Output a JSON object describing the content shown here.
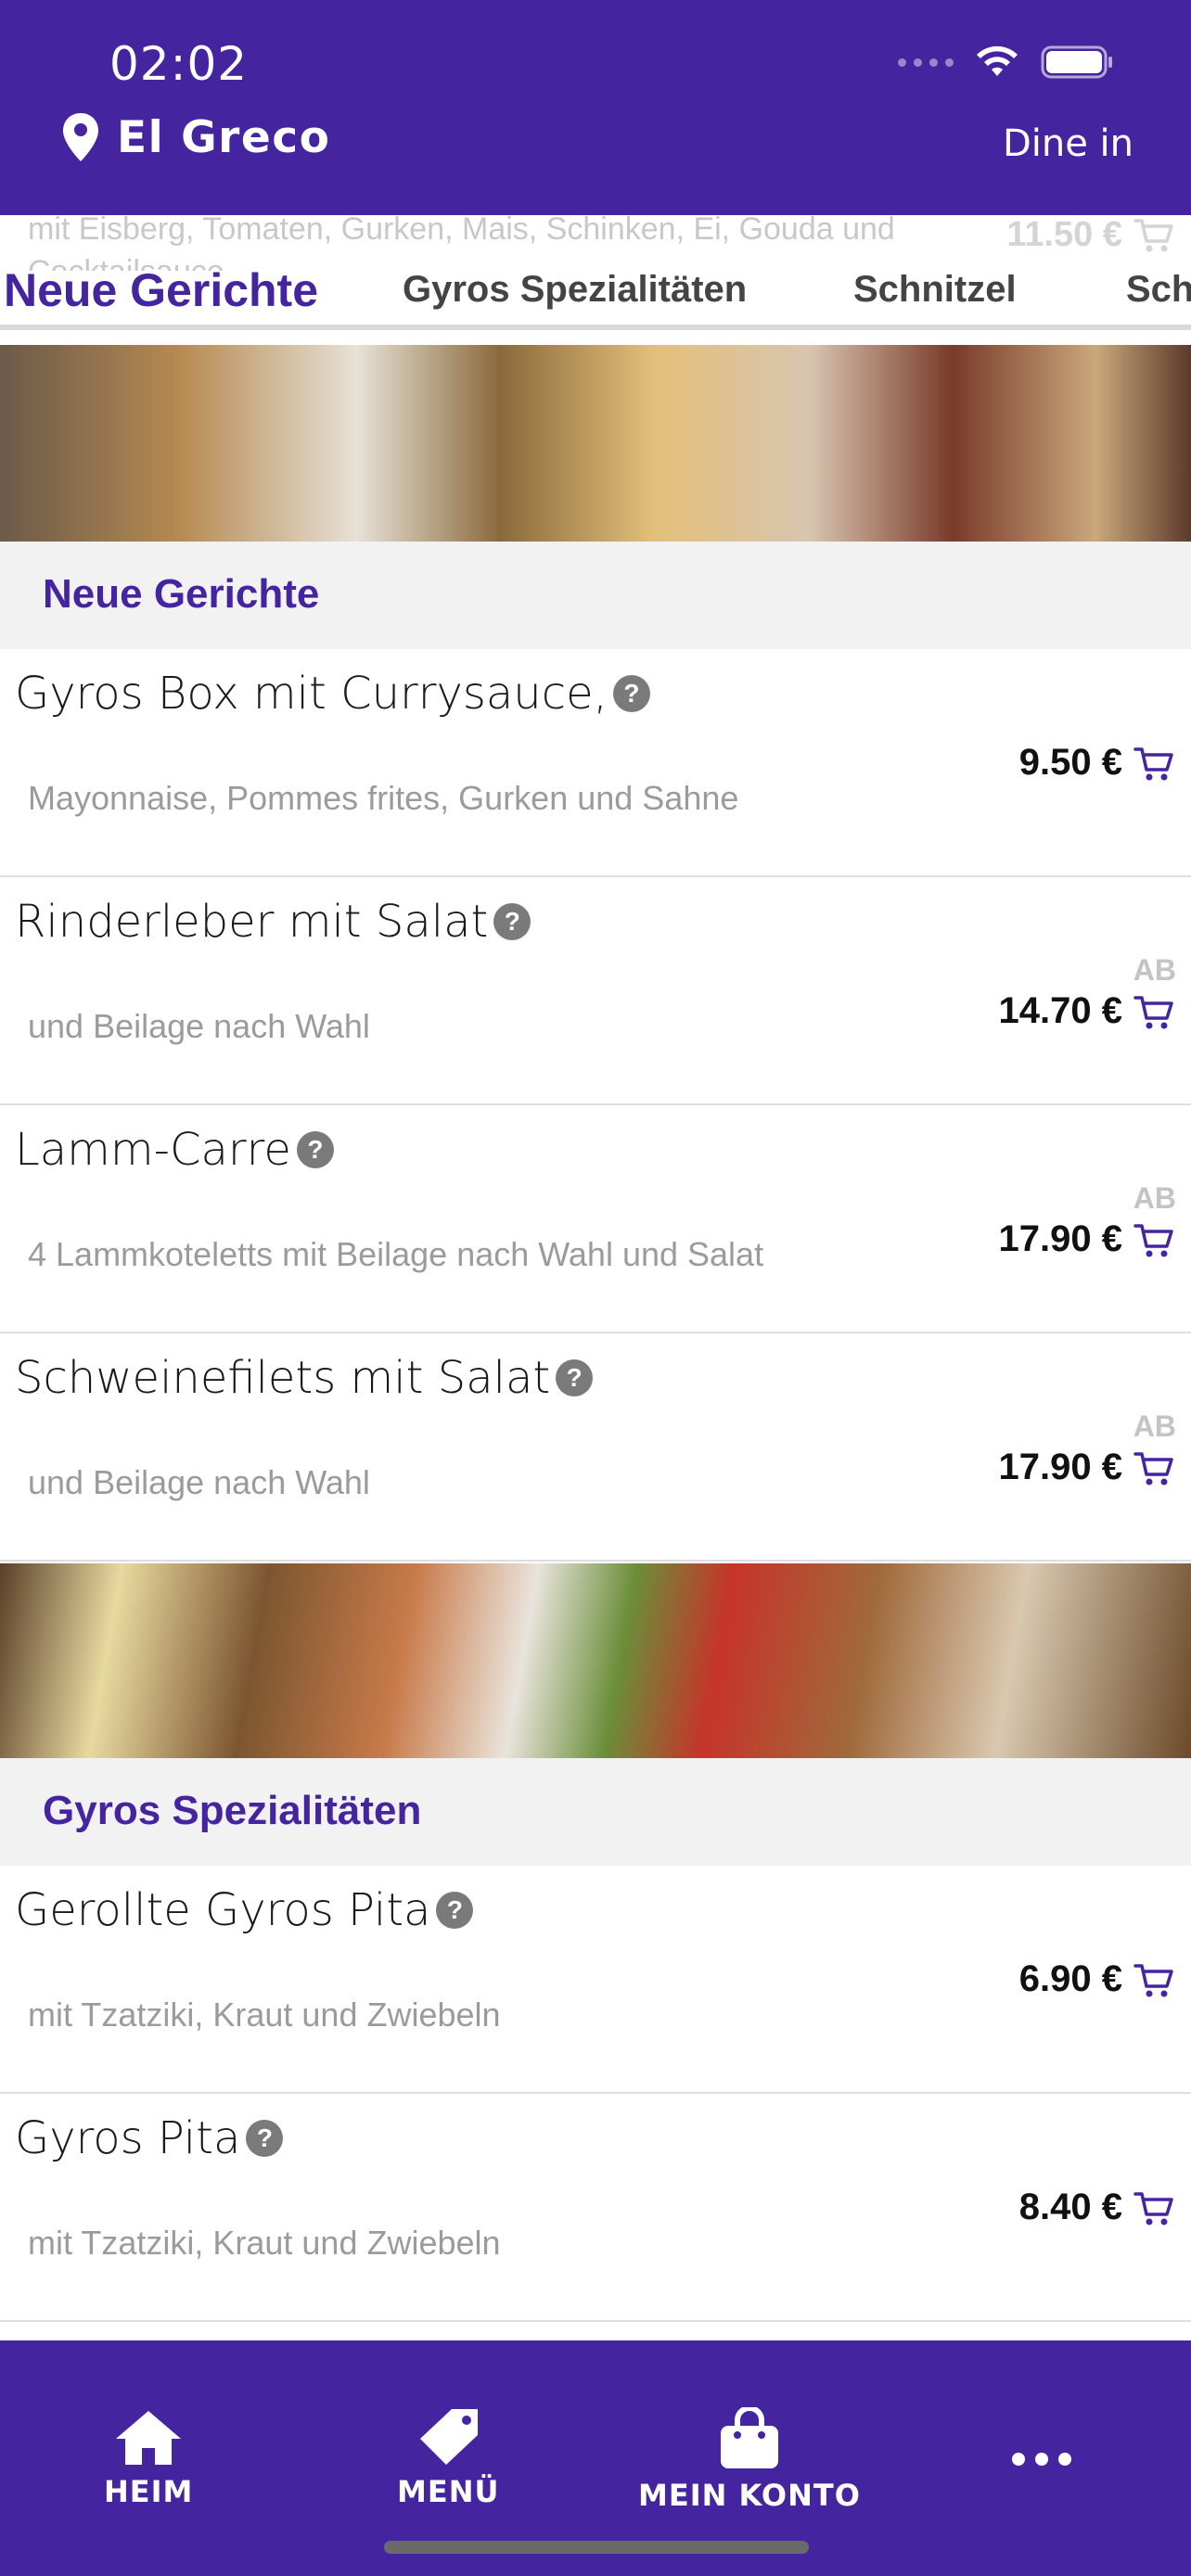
{
  "status_bar": {
    "time": "02:02"
  },
  "header": {
    "restaurant_name": "El Greco",
    "order_mode": "Dine in"
  },
  "peek_item": {
    "description": "mit Eisberg, Tomaten, Gurken, Mais, Schinken, Ei, Gouda und Cocktailsauce",
    "price": "11.50 €"
  },
  "tabs": [
    {
      "label": "Neue Gerichte",
      "active": true
    },
    {
      "label": "Gyros Spezialitäten",
      "active": false
    },
    {
      "label": "Schnitzel",
      "active": false
    },
    {
      "label": "Sch",
      "active": false
    }
  ],
  "sections": [
    {
      "title": "Neue Gerichte",
      "items": [
        {
          "name": "Gyros Box mit Currysauce,",
          "description": "Mayonnaise, Pommes frites, Gurken und Sahne",
          "price": "9.50 €",
          "prefix": ""
        },
        {
          "name": "Rinderleber mit Salat",
          "description": "und Beilage nach Wahl",
          "price": "14.70 €",
          "prefix": "AB"
        },
        {
          "name": "Lamm-Carre",
          "description": "4 Lammkoteletts mit Beilage nach Wahl und Salat",
          "price": "17.90 €",
          "prefix": "AB"
        },
        {
          "name": "Schweinefilets mit Salat",
          "description": "und Beilage nach Wahl",
          "price": "17.90 €",
          "prefix": "AB"
        }
      ]
    },
    {
      "title": "Gyros Spezialitäten",
      "items": [
        {
          "name": "Gerollte Gyros Pita",
          "description": "mit Tzatziki, Kraut und Zwiebeln",
          "price": "6.90 €",
          "prefix": ""
        },
        {
          "name": "Gyros Pita",
          "description": "mit Tzatziki, Kraut und Zwiebeln",
          "price": "8.40 €",
          "prefix": ""
        }
      ]
    }
  ],
  "help_glyph": "?",
  "bottom_nav": [
    {
      "label": "HEIM",
      "icon": "home-icon"
    },
    {
      "label": "MENÜ",
      "icon": "tag-icon"
    },
    {
      "label": "MEIN KONTO",
      "icon": "shopping-bag-icon"
    },
    {
      "label": "",
      "icon": "more-icon"
    }
  ],
  "colors": {
    "brand": "#4524a0",
    "section_bg": "#f2f2f2",
    "muted_text": "#9b9b9b"
  }
}
